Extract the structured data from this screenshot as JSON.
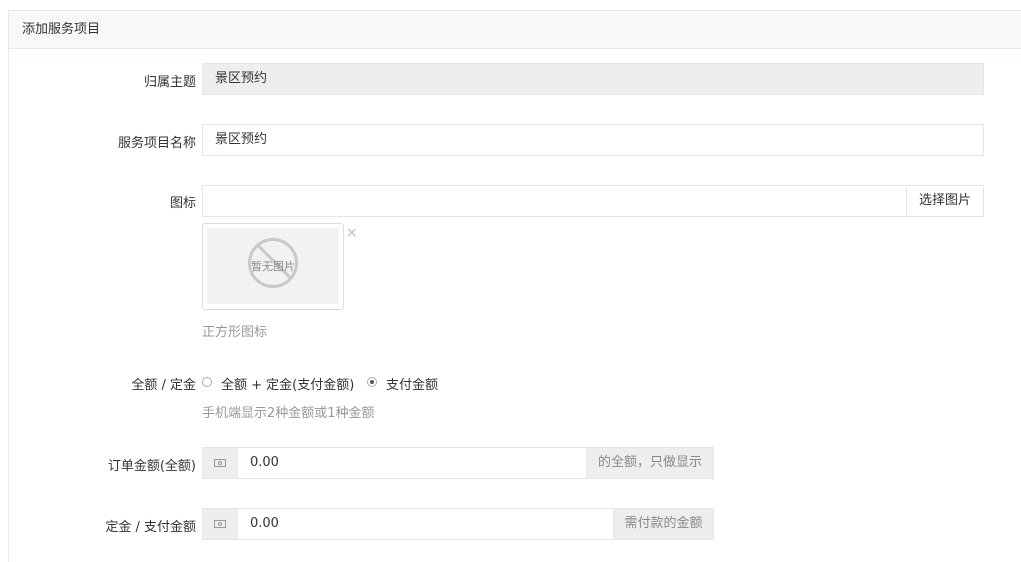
{
  "panel": {
    "title": "添加服务项目"
  },
  "form": {
    "theme": {
      "label": "归属主题",
      "value": "景区预约"
    },
    "service_name": {
      "label": "服务项目名称",
      "value": "景区预约"
    },
    "icon": {
      "label": "图标",
      "value": "",
      "choose_button": "选择图片",
      "no_image_text": "暂无图片",
      "remove_glyph": "×",
      "help": "正方形图标"
    },
    "amount_type": {
      "label": "全额 / 定金",
      "options": [
        {
          "label": "全额 + 定金(支付金额)",
          "checked": false
        },
        {
          "label": "支付金额",
          "checked": true
        }
      ],
      "help": "手机端显示2种金额或1种金额"
    },
    "order_amount": {
      "label": "订单金额(全额)",
      "value": "0.00",
      "suffix": "的全额，只做显示"
    },
    "deposit_amount": {
      "label": "定金 / 支付金额",
      "value": "0.00",
      "suffix": "需付款的金额"
    }
  }
}
